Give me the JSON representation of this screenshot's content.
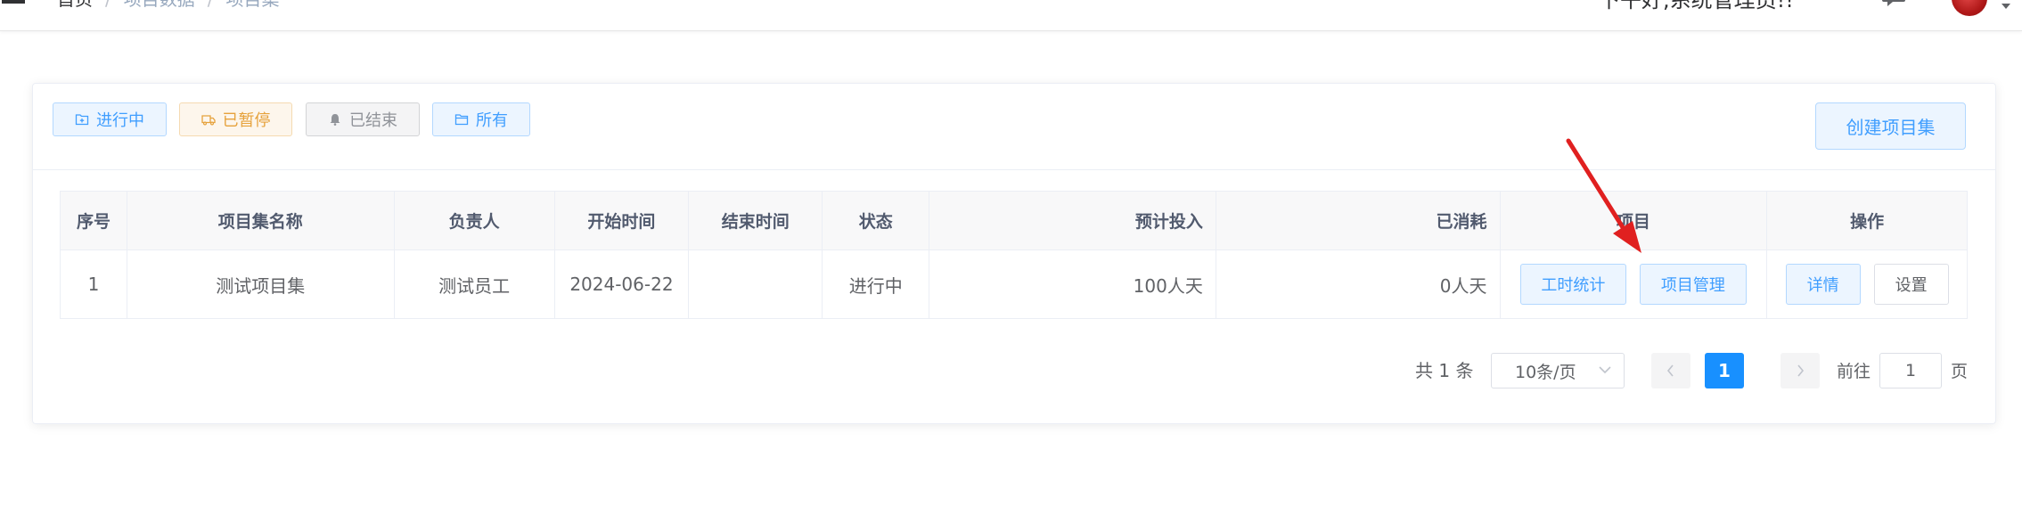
{
  "nav": {
    "breadcrumb": [
      "首页",
      "项目数据",
      "项目集"
    ],
    "separator": "/",
    "greeting": "下午好,系统管理员!!",
    "avatar_color": "#c21f1f"
  },
  "filters": [
    {
      "label": "进行中",
      "icon": "folder-add-icon",
      "color": "#409eff"
    },
    {
      "label": "已暂停",
      "icon": "truck-icon",
      "color": "#e6a23c"
    },
    {
      "label": "已结束",
      "icon": "bell-icon",
      "color": "#909399"
    },
    {
      "label": "所有",
      "icon": "folder-icon",
      "color": "#409eff"
    }
  ],
  "create_button": "创建项目集",
  "table": {
    "columns": [
      "序号",
      "项目集名称",
      "负责人",
      "开始时间",
      "结束时间",
      "状态",
      "预计投入",
      "已消耗",
      "项目",
      "操作"
    ],
    "rows": [
      {
        "index": "1",
        "name": "测试项目集",
        "owner": "测试员工",
        "start": "2024-06-22",
        "end": "",
        "status": "进行中",
        "planned": "100人天",
        "consumed": "0人天",
        "project_actions": [
          "工时统计",
          "项目管理"
        ],
        "ops": [
          "详情",
          "设置"
        ]
      }
    ]
  },
  "pagination": {
    "total_text": "共 1 条",
    "page_size": "10条/页",
    "current_page": "1",
    "goto_label": "前往",
    "goto_value": "1",
    "page_suffix": "页"
  },
  "colors": {
    "primary": "#409eff",
    "active_page": "#1890ff",
    "warning": "#e6a23c",
    "info": "#909399",
    "annotation_arrow": "#e02020"
  }
}
